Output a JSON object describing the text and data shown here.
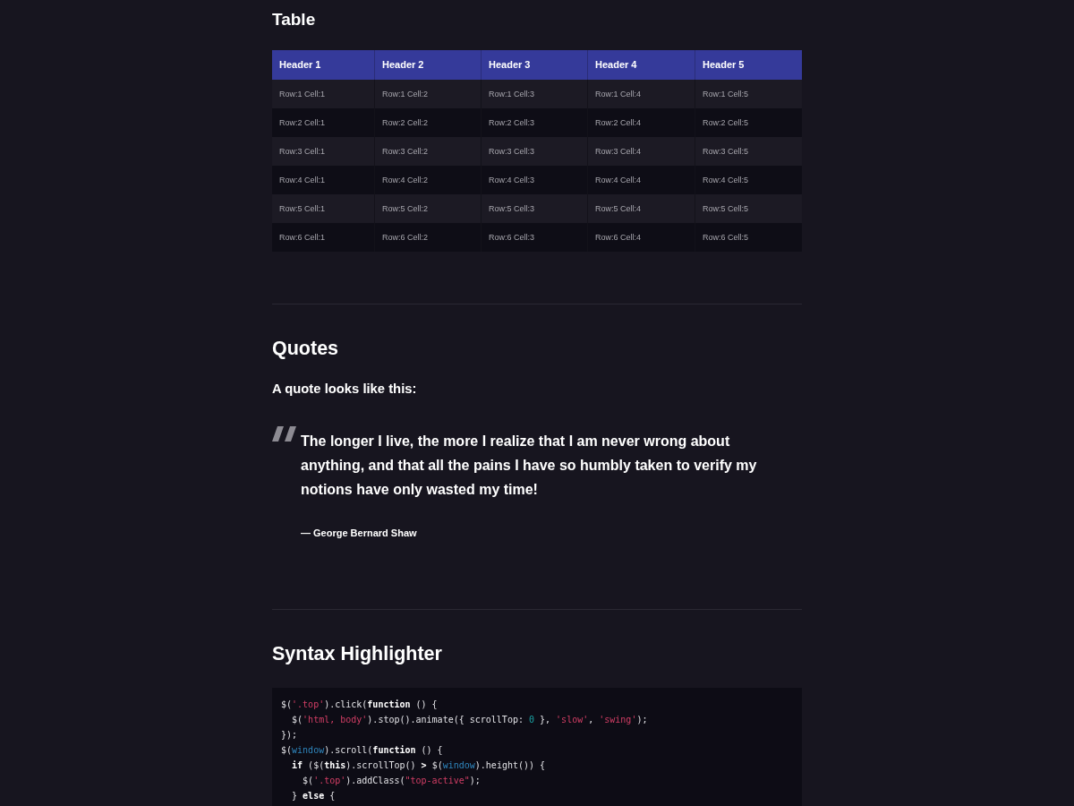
{
  "sections": [
    {
      "kind": "table",
      "heading": "Table",
      "table": {
        "columns": [
          "Header 1",
          "Header 2",
          "Header 3",
          "Header 4",
          "Header 5"
        ],
        "rows": [
          [
            "Row:1 Cell:1",
            "Row:1 Cell:2",
            "Row:1 Cell:3",
            "Row:1 Cell:4",
            "Row:1 Cell:5"
          ],
          [
            "Row:2 Cell:1",
            "Row:2 Cell:2",
            "Row:2 Cell:3",
            "Row:2 Cell:4",
            "Row:2 Cell:5"
          ],
          [
            "Row:3 Cell:1",
            "Row:3 Cell:2",
            "Row:3 Cell:3",
            "Row:3 Cell:4",
            "Row:3 Cell:5"
          ],
          [
            "Row:4 Cell:1",
            "Row:4 Cell:2",
            "Row:4 Cell:3",
            "Row:4 Cell:4",
            "Row:4 Cell:5"
          ],
          [
            "Row:5 Cell:1",
            "Row:5 Cell:2",
            "Row:5 Cell:3",
            "Row:5 Cell:4",
            "Row:5 Cell:5"
          ],
          [
            "Row:6 Cell:1",
            "Row:6 Cell:2",
            "Row:6 Cell:3",
            "Row:6 Cell:4",
            "Row:6 Cell:5"
          ]
        ]
      }
    },
    {
      "kind": "quote",
      "heading": "Quotes",
      "intro": "A quote looks like this:",
      "quote": {
        "text": "The longer I live, the more I realize that I am never wrong about anything, and that all the pains I have so humbly taken to verify my notions have only wasted my time!",
        "author": "— George Bernard Shaw"
      }
    },
    {
      "kind": "code",
      "heading": "Syntax Highlighter",
      "code": {
        "lines": [
          [
            {
              "kind": "plain",
              "text": "$("
            },
            {
              "kind": "string",
              "text": "'.top'"
            },
            {
              "kind": "plain",
              "text": ").click("
            },
            {
              "kind": "keyword",
              "text": "function"
            },
            {
              "kind": "plain",
              "text": " () {"
            }
          ],
          [
            {
              "kind": "plain",
              "text": "  $("
            },
            {
              "kind": "string",
              "text": "'html, body'"
            },
            {
              "kind": "plain",
              "text": ").stop().animate({ scrollTop: "
            },
            {
              "kind": "number",
              "text": "0"
            },
            {
              "kind": "plain",
              "text": " }, "
            },
            {
              "kind": "string",
              "text": "'slow'"
            },
            {
              "kind": "plain",
              "text": ", "
            },
            {
              "kind": "string",
              "text": "'swing'"
            },
            {
              "kind": "plain",
              "text": ");"
            }
          ],
          [
            {
              "kind": "plain",
              "text": "});"
            }
          ],
          [
            {
              "kind": "plain",
              "text": "$("
            },
            {
              "kind": "builtin",
              "text": "window"
            },
            {
              "kind": "plain",
              "text": ").scroll("
            },
            {
              "kind": "keyword",
              "text": "function"
            },
            {
              "kind": "plain",
              "text": " () {"
            }
          ],
          [
            {
              "kind": "keyword",
              "text": "  if"
            },
            {
              "kind": "plain",
              "text": " ($("
            },
            {
              "kind": "keyword",
              "text": "this"
            },
            {
              "kind": "plain",
              "text": ").scrollTop() "
            },
            {
              "kind": "keyword",
              "text": ">"
            },
            {
              "kind": "plain",
              "text": " $("
            },
            {
              "kind": "builtin",
              "text": "window"
            },
            {
              "kind": "plain",
              "text": ").height()) {"
            }
          ],
          [
            {
              "kind": "plain",
              "text": "    $("
            },
            {
              "kind": "string",
              "text": "'.top'"
            },
            {
              "kind": "plain",
              "text": ").addClass("
            },
            {
              "kind": "string",
              "text": "\"top-active\""
            },
            {
              "kind": "plain",
              "text": ");"
            }
          ],
          [
            {
              "kind": "plain",
              "text": "  } "
            },
            {
              "kind": "keyword",
              "text": "else"
            },
            {
              "kind": "plain",
              "text": " {"
            }
          ]
        ]
      }
    }
  ]
}
